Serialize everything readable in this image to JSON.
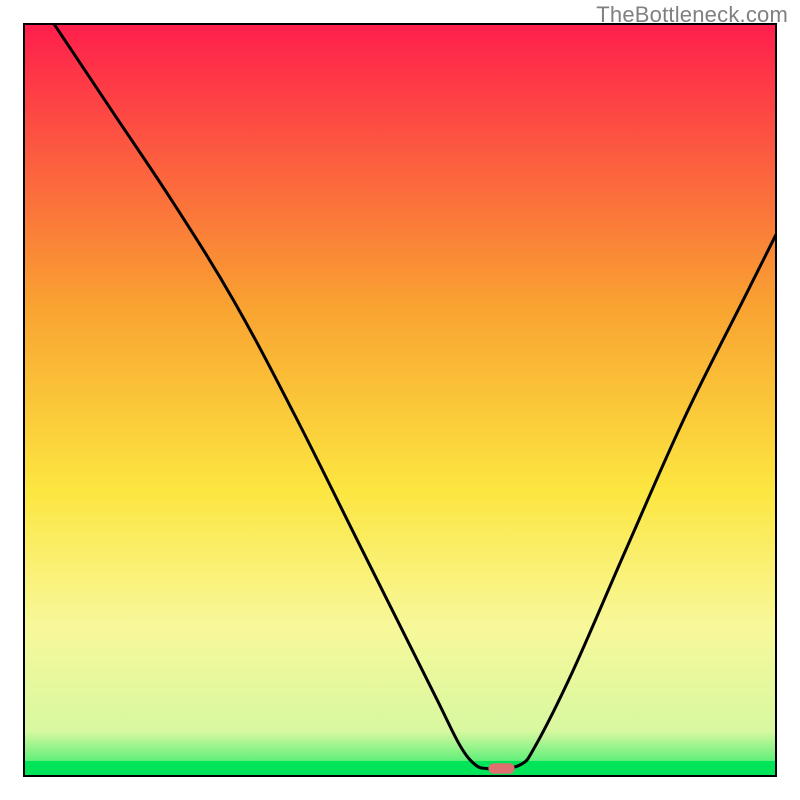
{
  "watermark": "TheBottleneck.com",
  "chart_data": {
    "type": "line",
    "title": "",
    "xlabel": "",
    "ylabel": "",
    "x_range": [
      0,
      100
    ],
    "y_range": [
      0,
      100
    ],
    "gradient_colors": {
      "top": "#FF1E4C",
      "mid_upper": "#F9A431",
      "mid": "#FCE640",
      "mid_lower": "#F8F89A",
      "green_band": "#00E45A",
      "bottom": "#00E45A"
    },
    "series": [
      {
        "name": "bottleneck-curve",
        "x": [
          4,
          12,
          20,
          28,
          36,
          44,
          50,
          55,
          58,
          60,
          61.5,
          63,
          66,
          68,
          73,
          80,
          88,
          96,
          100
        ],
        "y": [
          100,
          88,
          76,
          63,
          48,
          32,
          20,
          10,
          4,
          1.5,
          1,
          1,
          1.5,
          4,
          14,
          30,
          48,
          64,
          72
        ]
      }
    ],
    "marker": {
      "x": 63.5,
      "y": 1.0,
      "w": 3.5,
      "h": 1.4,
      "rx": 1.4,
      "color": "#E07070"
    },
    "frame": {
      "inset": 24,
      "stroke": "#000000",
      "stroke_width": 2
    }
  }
}
